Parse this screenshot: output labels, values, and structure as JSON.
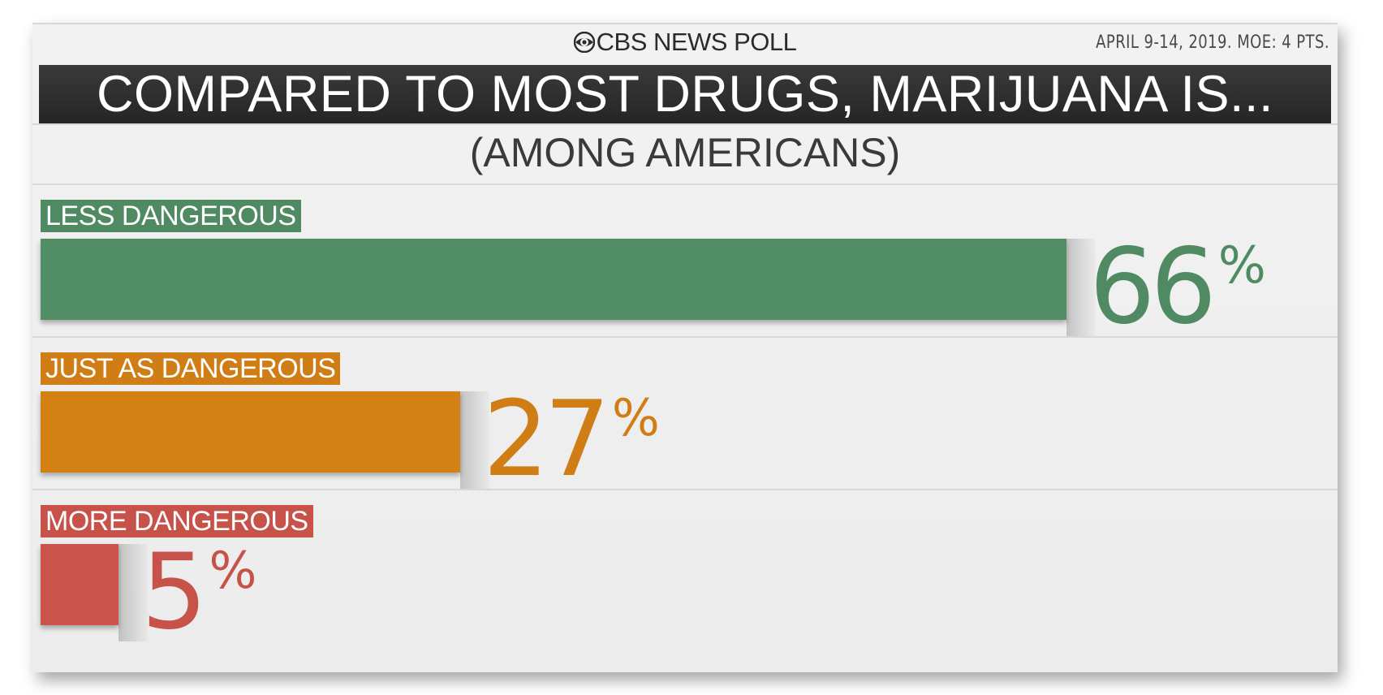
{
  "header": {
    "brand": "CBS NEWS POLL",
    "dateline": "APRIL 9-14, 2019. MOE: 4 PTS."
  },
  "chart_data": {
    "type": "bar",
    "orientation": "horizontal",
    "title": "COMPARED TO MOST DRUGS, MARIJUANA IS...",
    "subtitle": "(AMONG AMERICANS)",
    "categories": [
      "LESS DANGEROUS",
      "JUST AS DANGEROUS",
      "MORE DANGEROUS"
    ],
    "values": [
      66,
      27,
      5
    ],
    "value_suffix": "%",
    "colors": [
      "#4f8a63",
      "#cf7d14",
      "#c6524a"
    ],
    "xlim": [
      0,
      66
    ],
    "grid": false,
    "legend": "none"
  }
}
